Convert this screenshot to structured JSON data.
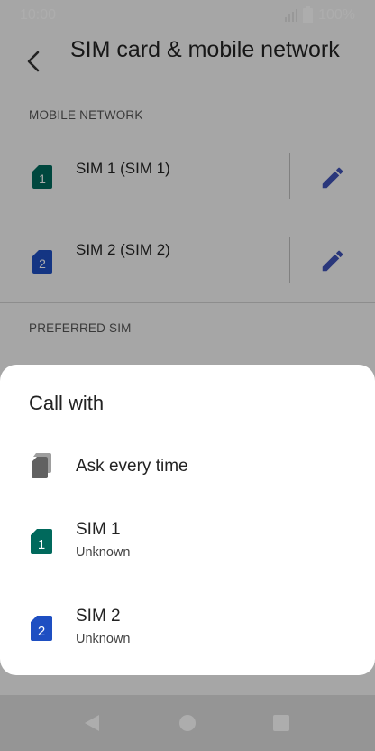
{
  "status_bar": {
    "time": "10:00",
    "battery": "100%"
  },
  "header": {
    "title": "SIM card & mobile network"
  },
  "sections": {
    "mobile_network": "MOBILE NETWORK",
    "preferred_sim": "PREFERRED SIM"
  },
  "sims": [
    {
      "label": "SIM 1 (SIM 1)",
      "badge": "1",
      "color": "#00695c"
    },
    {
      "label": "SIM 2 (SIM 2)",
      "badge": "2",
      "color": "#1e4fc2"
    }
  ],
  "dialog": {
    "title": "Call with",
    "options": [
      {
        "label": "Ask every time",
        "sublabel": ""
      },
      {
        "label": "SIM 1",
        "sublabel": "Unknown",
        "badge": "1",
        "color": "#00695c"
      },
      {
        "label": "SIM 2",
        "sublabel": "Unknown",
        "badge": "2",
        "color": "#1e4fc2"
      }
    ]
  },
  "icons": {
    "back": "arrow-back-icon",
    "edit": "pencil-icon",
    "ask": "sim-cards-icon",
    "nav_back": "triangle-back-icon",
    "nav_home": "circle-home-icon",
    "nav_recent": "square-recents-icon"
  },
  "colors": {
    "accent": "#3f51b5",
    "scrim": "rgba(0,0,0,0.32)"
  }
}
